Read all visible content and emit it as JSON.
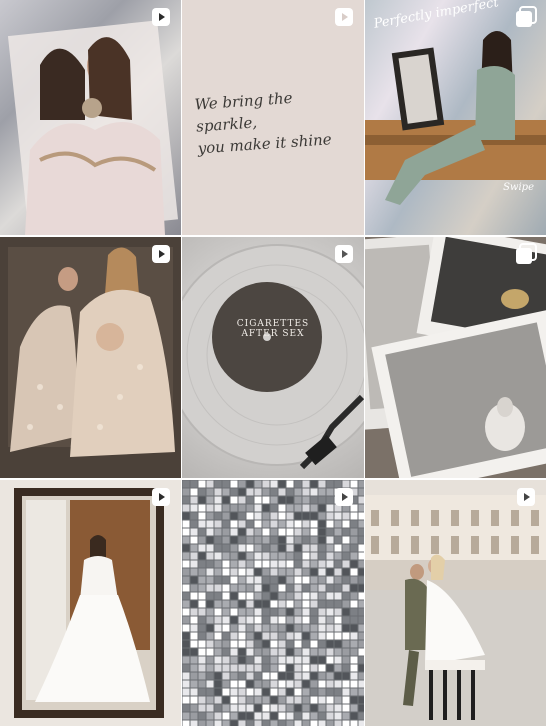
{
  "grid": {
    "tiles": [
      {
        "kind": "reel",
        "icon": "reel-icon"
      },
      {
        "kind": "reel",
        "icon": "reel-icon",
        "quote": "We bring the sparkle,\nyou make it shine"
      },
      {
        "kind": "carousel",
        "icon": "carousel-icon",
        "caption": "Perfectly imperfect",
        "swipe": "Swipe"
      },
      {
        "kind": "reel",
        "icon": "reel-icon"
      },
      {
        "kind": "reel",
        "icon": "reel-icon",
        "record_label": "CIGARETTES AFTER SEX"
      },
      {
        "kind": "carousel",
        "icon": "carousel-icon"
      },
      {
        "kind": "reel",
        "icon": "reel-icon"
      },
      {
        "kind": "reel",
        "icon": "reel-icon"
      },
      {
        "kind": "reel",
        "icon": "reel-icon"
      }
    ]
  },
  "colors": {
    "icon": "#ffffff",
    "background": "#ffffff"
  }
}
